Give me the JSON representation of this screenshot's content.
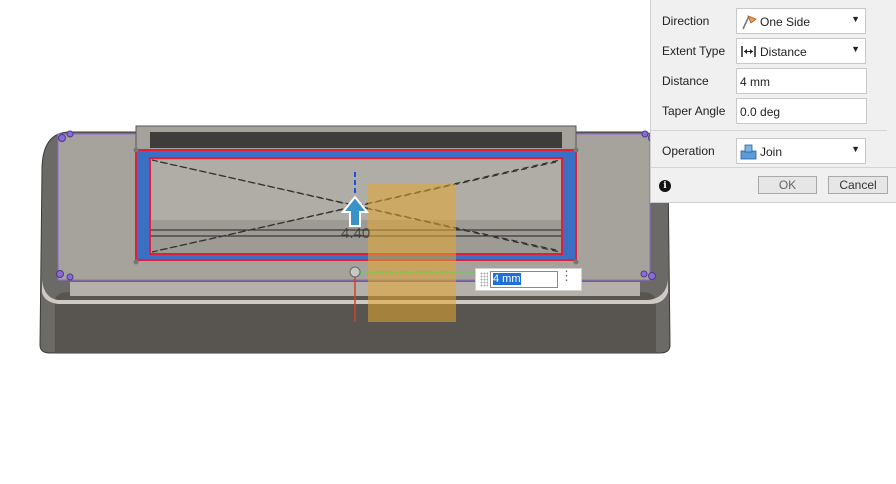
{
  "panel": {
    "direction": {
      "label": "Direction",
      "value": "One Side",
      "icon": "one-side-direction-icon"
    },
    "extent_type": {
      "label": "Extent Type",
      "value": "Distance",
      "icon": "distance-extent-icon"
    },
    "distance": {
      "label": "Distance",
      "value": "4 mm"
    },
    "taper_angle": {
      "label": "Taper Angle",
      "value": "0.0 deg"
    },
    "operation": {
      "label": "Operation",
      "value": "Join",
      "icon": "join-operation-icon"
    },
    "ok_label": "OK",
    "cancel_label": "Cancel"
  },
  "canvas": {
    "dimension_label": "4.40",
    "distance_input_value": "4 mm",
    "colors": {
      "selection_outline": "#e0203a",
      "profile_blue": "#3a6fc4",
      "preview_orange": "#e3a530",
      "manipulator_arrow": "#3a93c8",
      "sketch_purple": "#8c6bd6"
    }
  }
}
